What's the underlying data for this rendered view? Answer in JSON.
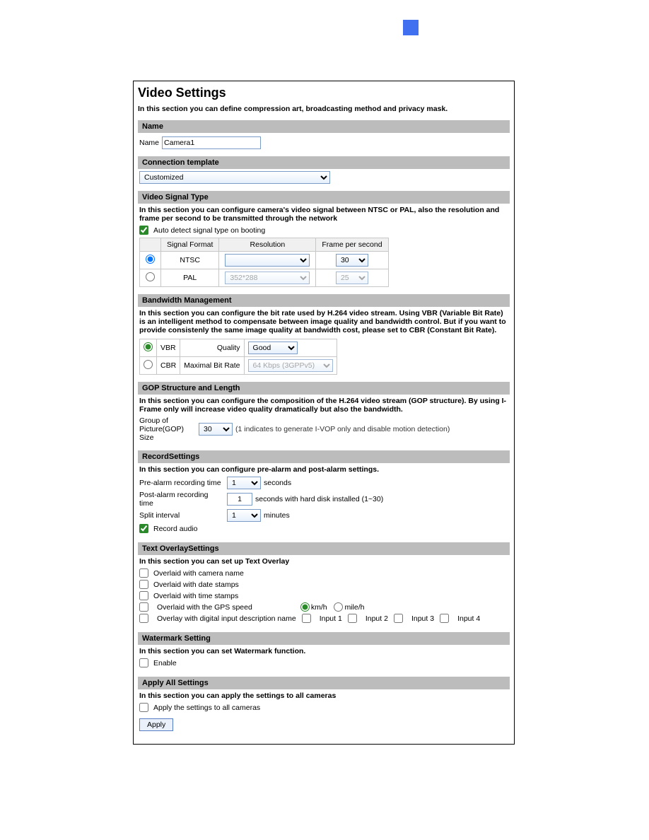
{
  "title": "Video Settings",
  "intro": "In this section you can define compression art, broadcasting method and privacy mask.",
  "sections": {
    "name": {
      "head": "Name",
      "label": "Name",
      "value": "Camera1"
    },
    "conn": {
      "head": "Connection template",
      "value": "Customized"
    },
    "vst": {
      "head": "Video Signal Type",
      "desc": "In this section you can configure camera's video signal between NTSC or PAL, also the resolution and frame per second to be transmitted through the network",
      "autodetect": "Auto detect signal type on booting",
      "cols": {
        "blank": "",
        "format": "Signal Format",
        "res": "Resolution",
        "fps": "Frame per second"
      },
      "rows": [
        {
          "format": "NTSC",
          "res": "",
          "fps": "30",
          "sel": true
        },
        {
          "format": "PAL",
          "res": "352*288",
          "fps": "25",
          "sel": false
        }
      ]
    },
    "bw": {
      "head": "Bandwidth Management",
      "desc": "In this section you can configure the bit rate used by H.264 video stream. Using VBR (Variable Bit Rate) is an intelligent method to compensate between image quality and bandwidth control. But if you want to provide consistenly the same image quality at bandwidth cost, please set to CBR (Constant Bit Rate).",
      "vbr": "VBR",
      "quality_lbl": "Quality",
      "quality_val": "Good",
      "cbr": "CBR",
      "maxbr_lbl": "Maximal Bit Rate",
      "maxbr_val": "64 Kbps (3GPPv5)"
    },
    "gop": {
      "head": "GOP Structure and Length",
      "desc": "In this section you can configure the composition of the H.264 video stream (GOP structure). By using I-Frame only will increase video quality dramatically but also the bandwidth.",
      "label": "Group of Picture(GOP) Size",
      "value": "30",
      "hint": "(1 indicates to generate I-VOP only and disable motion detection)"
    },
    "rec": {
      "head": "RecordSettings",
      "desc": "In this section you can configure pre-alarm and post-alarm settings.",
      "pre_lbl": "Pre-alarm recording time",
      "pre_val": "1",
      "sec": "seconds",
      "post_lbl": "Post-alarm recording time",
      "post_val": "1",
      "post_hint": "seconds with hard disk installed (1~30)",
      "split_lbl": "Split interval",
      "split_val": "1",
      "min": "minutes",
      "rec_audio": "Record audio"
    },
    "txt": {
      "head": "Text OverlaySettings",
      "desc": "In this section you can set up Text Overlay",
      "cam": "Overlaid with camera name",
      "date": "Overlaid with date stamps",
      "time": "Overlaid with time stamps",
      "gps": "Overlaid with the GPS speed",
      "km": "km/h",
      "mile": "mile/h",
      "dig": "Overlay with digital input description name",
      "in1": "Input 1",
      "in2": "Input 2",
      "in3": "Input 3",
      "in4": "Input 4"
    },
    "wm": {
      "head": "Watermark Setting",
      "desc": "In this section you can set Watermark function.",
      "enable": "Enable"
    },
    "apply": {
      "head": "Apply All Settings",
      "desc": "In this section you can apply the settings to all cameras",
      "lbl": "Apply the settings to all cameras",
      "btn": "Apply"
    }
  }
}
